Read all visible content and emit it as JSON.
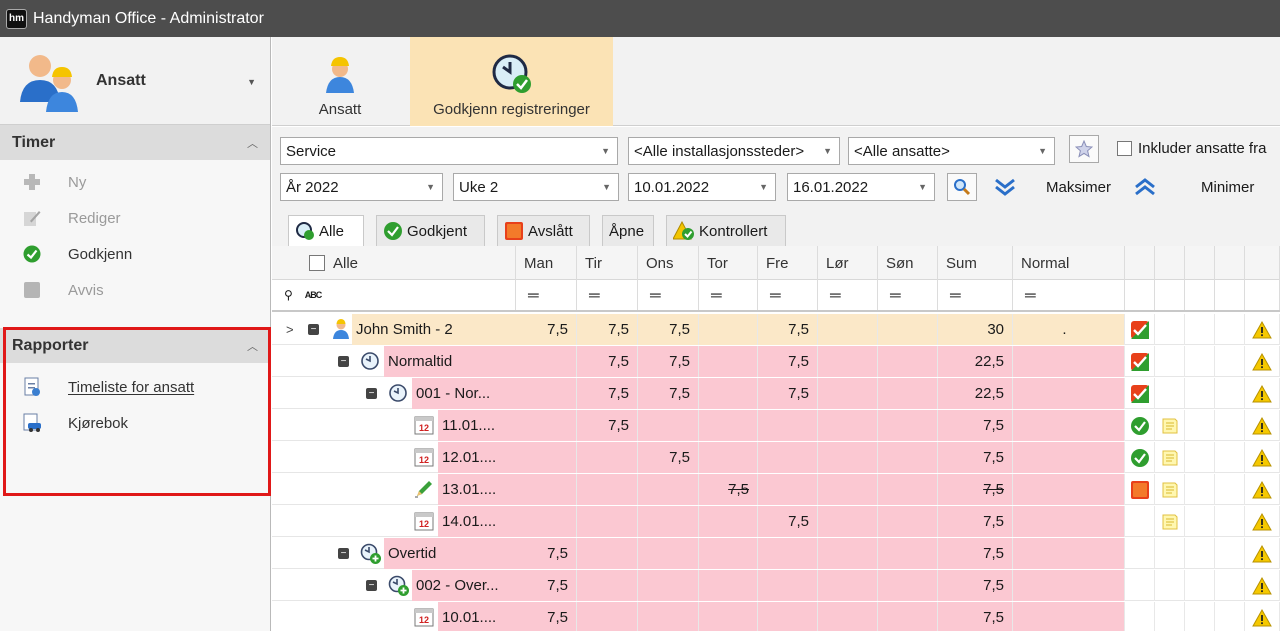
{
  "window": {
    "title": "Handyman Office - Administrator",
    "app_icon": "hm"
  },
  "left_panel": {
    "user_label": "Ansatt",
    "timer": {
      "title": "Timer",
      "items": [
        {
          "label": "Ny",
          "icon": "plus-icon",
          "enabled": false
        },
        {
          "label": "Rediger",
          "icon": "edit-icon",
          "enabled": false
        },
        {
          "label": "Godkjenn",
          "icon": "check-icon",
          "enabled": true
        },
        {
          "label": "Avvis",
          "icon": "reject-icon",
          "enabled": false
        }
      ]
    },
    "rapporter": {
      "title": "Rapporter",
      "items": [
        {
          "label": "Timeliste for ansatt",
          "icon": "report-icon"
        },
        {
          "label": "Kjørebok",
          "icon": "car-log-icon"
        }
      ]
    }
  },
  "ribbon": {
    "buttons": [
      {
        "label": "Ansatt",
        "active": false
      },
      {
        "label": "Godkjenn registreringer",
        "active": true
      }
    ]
  },
  "filters": {
    "service": "Service",
    "locations": "<Alle installasjonssteder>",
    "employees": "<Alle ansatte>",
    "include_label": "Inkluder ansatte fra",
    "year": "År 2022",
    "week": "Uke 2",
    "date_from": "10.01.2022",
    "date_to": "16.01.2022",
    "maximize_label": "Maksimer",
    "minimize_label": "Minimer"
  },
  "tabs": [
    {
      "label": "Alle",
      "active": true
    },
    {
      "label": "Godkjent",
      "active": false
    },
    {
      "label": "Avslått",
      "active": false
    },
    {
      "label": "Åpne",
      "active": false
    },
    {
      "label": "Kontrollert",
      "active": false
    }
  ],
  "grid": {
    "name_header": "Alle",
    "columns": [
      "Man",
      "Tir",
      "Ons",
      "Tor",
      "Fre",
      "Lør",
      "Søn",
      "Sum",
      "Normal"
    ],
    "filter_glyph": "═",
    "rows": [
      {
        "level": 0,
        "name": "John Smith - 2",
        "bg": "tan",
        "icon": "person-icon",
        "values": [
          "7,5",
          "7,5",
          "7,5",
          "",
          "7,5",
          "",
          "",
          "30"
        ],
        "normal": ".",
        "status": "approved-partial",
        "note": false
      },
      {
        "level": 1,
        "name": "Normaltid",
        "bg": "pink",
        "icon": "clock-icon",
        "values": [
          "",
          "7,5",
          "7,5",
          "",
          "7,5",
          "",
          "",
          "22,5"
        ],
        "normal": "",
        "status": "approved-partial",
        "note": false
      },
      {
        "level": 2,
        "name": "001 - Nor...",
        "bg": "pink",
        "icon": "clock-icon",
        "values": [
          "",
          "7,5",
          "7,5",
          "",
          "7,5",
          "",
          "",
          "22,5"
        ],
        "normal": "",
        "status": "approved-partial",
        "note": false
      },
      {
        "level": 3,
        "name": "11.01....",
        "bg": "pink",
        "icon": "calendar-icon",
        "values": [
          "",
          "7,5",
          "",
          "",
          "",
          "",
          "",
          "7,5"
        ],
        "normal": "",
        "status": "approved",
        "note": true
      },
      {
        "level": 3,
        "name": "12.01....",
        "bg": "pink",
        "icon": "calendar-icon",
        "values": [
          "",
          "",
          "7,5",
          "",
          "",
          "",
          "",
          "7,5"
        ],
        "normal": "",
        "status": "approved",
        "note": true
      },
      {
        "level": 3,
        "name": "13.01....",
        "bg": "pink",
        "icon": "pencil-icon",
        "values": [
          "",
          "",
          "",
          "7,5",
          "",
          "",
          "",
          "7,5"
        ],
        "normal": "",
        "status": "rejected",
        "note": true,
        "struck": true
      },
      {
        "level": 3,
        "name": "14.01....",
        "bg": "pink",
        "icon": "calendar-icon",
        "values": [
          "",
          "",
          "",
          "",
          "7,5",
          "",
          "",
          "7,5"
        ],
        "normal": "",
        "status": "",
        "note": true
      },
      {
        "level": 1,
        "name": "Overtid",
        "bg": "pink",
        "icon": "clock-plus-icon",
        "values": [
          "7,5",
          "",
          "",
          "",
          "",
          "",
          "",
          "7,5"
        ],
        "normal": "",
        "status": "",
        "note": false
      },
      {
        "level": 2,
        "name": "002 - Over...",
        "bg": "pink",
        "icon": "clock-plus-icon",
        "values": [
          "7,5",
          "",
          "",
          "",
          "",
          "",
          "",
          "7,5"
        ],
        "normal": "",
        "status": "",
        "note": false
      },
      {
        "level": 3,
        "name": "10.01....",
        "bg": "pink",
        "icon": "calendar-icon",
        "values": [
          "7,5",
          "",
          "",
          "",
          "",
          "",
          "",
          "7,5"
        ],
        "normal": "",
        "status": "",
        "note": false
      }
    ]
  },
  "colors": {
    "approved": "#2f9e2f",
    "rejected": "#e8401a",
    "tan_row": "#fbe8c8",
    "pink_row": "#fbc8d2",
    "ribbon_active": "#fbe3b5"
  }
}
